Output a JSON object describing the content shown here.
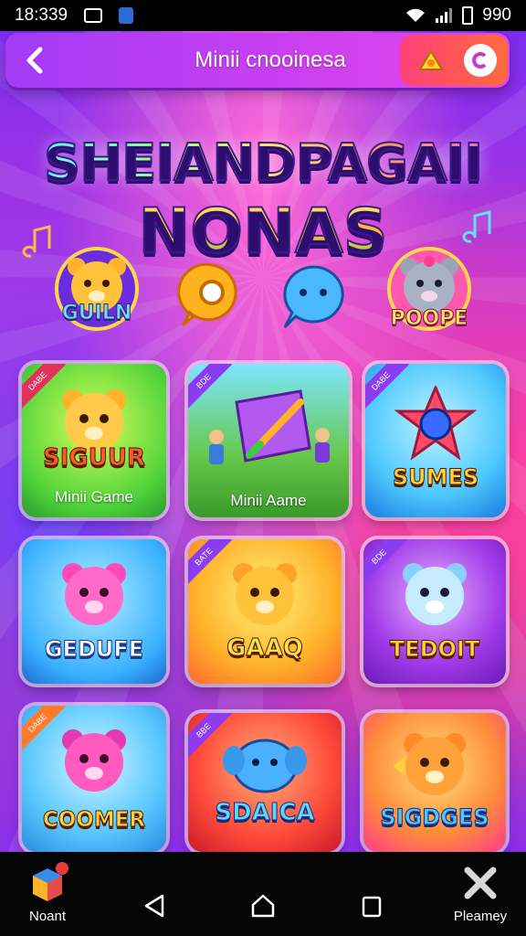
{
  "status_bar": {
    "time": "18:339",
    "battery_text": "990"
  },
  "header": {
    "title": "Minii cnooinesa"
  },
  "logo": {
    "line1": "SHEIANDPAGAII",
    "line2": "NONAS"
  },
  "characters": [
    {
      "label": "GUILN",
      "icon": "bear-badge-icon"
    },
    {
      "label": "",
      "icon": "orange-bubble-icon"
    },
    {
      "label": "",
      "icon": "blue-bubble-icon"
    },
    {
      "label": "POOPE",
      "icon": "cat-badge-icon"
    }
  ],
  "tiles": [
    {
      "word": "SIGUUR",
      "caption": "Minii Game",
      "ribbon": "DABE"
    },
    {
      "word": "",
      "caption": "Minii Aame",
      "ribbon": "BDE"
    },
    {
      "word": "SUMES",
      "caption": "",
      "ribbon": "DABE"
    },
    {
      "word": "GEDUFE",
      "caption": "",
      "ribbon": ""
    },
    {
      "word": "GAAQ",
      "caption": "",
      "ribbon": "BATE"
    },
    {
      "word": "TEDOIT",
      "caption": "",
      "ribbon": "BDE"
    },
    {
      "word": "COOMER",
      "caption": "",
      "ribbon": "DABE"
    },
    {
      "word": "SDAICA",
      "caption": "",
      "ribbon": "BBE"
    },
    {
      "word": "SIGDGES",
      "caption": "",
      "ribbon": ""
    }
  ],
  "nav": {
    "left_label": "Noant",
    "right_label": "Pleamey"
  },
  "colors": {
    "header": "#c63ef2",
    "accent": "#ff3f7a"
  }
}
